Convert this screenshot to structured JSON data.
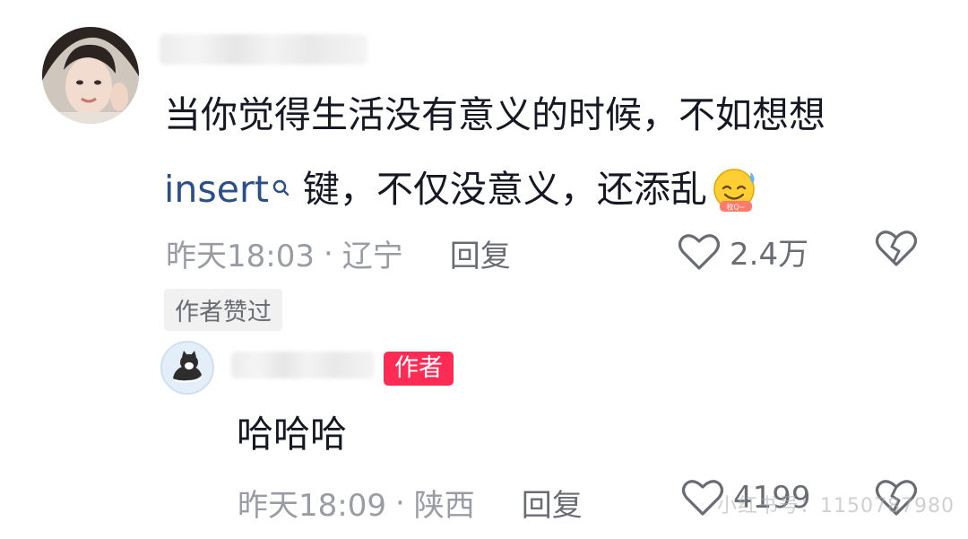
{
  "main_comment": {
    "text_line1": "当你觉得生活没有意义的时候，不如想想",
    "keyword": "insert",
    "text_line2": "键，不仅没意义，还添乱",
    "time": "昨天18:03",
    "location": "辽宁",
    "reply_label": "回复",
    "like_count": "2.4万",
    "liked_badge": "作者赞过"
  },
  "reply_comment": {
    "author_tag": "作者",
    "text": "哈哈哈",
    "time": "昨天18:09",
    "location": "陕西",
    "reply_label": "回复",
    "like_count": "4199"
  },
  "separator": "·",
  "watermark": "小红书号：1150787980",
  "colors": {
    "author_tag_bg": "#fe2c55",
    "keyword": "#2b4f87",
    "meta_text": "#9a9ca3"
  }
}
